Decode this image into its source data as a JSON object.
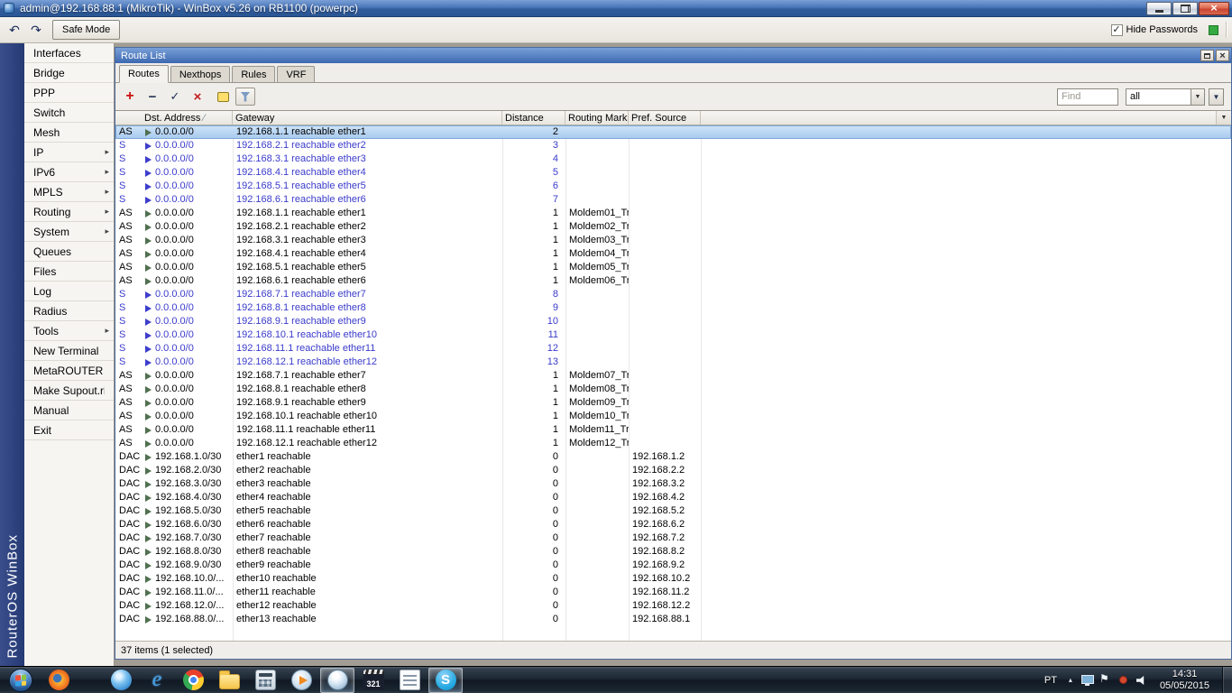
{
  "titlebar": {
    "title": "admin@192.168.88.1 (MikroTik) - WinBox v5.26 on RB1100 (powerpc)"
  },
  "app_toolbar": {
    "icons": [
      "undo-icon",
      "redo-icon"
    ],
    "safe_mode_label": "Safe Mode",
    "hide_passwords_label": "Hide Passwords",
    "hide_passwords_checked": true,
    "status_square_color": "#36a943"
  },
  "sidebar": {
    "brand": "RouterOS WinBox",
    "items": [
      {
        "label": "Interfaces",
        "submenu": false
      },
      {
        "label": "Bridge",
        "submenu": false
      },
      {
        "label": "PPP",
        "submenu": false
      },
      {
        "label": "Switch",
        "submenu": false
      },
      {
        "label": "Mesh",
        "submenu": false
      },
      {
        "label": "IP",
        "submenu": true
      },
      {
        "label": "IPv6",
        "submenu": true
      },
      {
        "label": "MPLS",
        "submenu": true
      },
      {
        "label": "Routing",
        "submenu": true
      },
      {
        "label": "System",
        "submenu": true
      },
      {
        "label": "Queues",
        "submenu": false
      },
      {
        "label": "Files",
        "submenu": false
      },
      {
        "label": "Log",
        "submenu": false
      },
      {
        "label": "Radius",
        "submenu": false
      },
      {
        "label": "Tools",
        "submenu": true
      },
      {
        "label": "New Terminal",
        "submenu": false
      },
      {
        "label": "MetaROUTER",
        "submenu": false
      },
      {
        "label": "Make Supout.rif",
        "submenu": false
      },
      {
        "label": "Manual",
        "submenu": false
      },
      {
        "label": "Exit",
        "submenu": false
      }
    ]
  },
  "route_list": {
    "window_title": "Route List",
    "tabs": [
      "Routes",
      "Nexthops",
      "Rules",
      "VRF"
    ],
    "toolbar_icons": [
      "add-icon",
      "remove-icon",
      "enable-icon",
      "disable-icon",
      "comment-icon",
      "filter-icon"
    ],
    "find_placeholder": "Find",
    "filter_selected": "all",
    "columns": [
      "Dst. Address",
      "Gateway",
      "Distance",
      "Routing Mark",
      "Pref. Source"
    ],
    "sorted_column": "Dst. Address",
    "status_text": "37 items (1 selected)",
    "rows": [
      {
        "flags": "AS",
        "dst": "0.0.0.0/0",
        "gateway": "192.168.1.1 reachable ether1",
        "distance": "2",
        "mark": "",
        "pref": "",
        "selected": true,
        "inactive": false
      },
      {
        "flags": "S",
        "dst": "0.0.0.0/0",
        "gateway": "192.168.2.1 reachable ether2",
        "distance": "3",
        "mark": "",
        "pref": "",
        "inactive": true
      },
      {
        "flags": "S",
        "dst": "0.0.0.0/0",
        "gateway": "192.168.3.1 reachable ether3",
        "distance": "4",
        "mark": "",
        "pref": "",
        "inactive": true
      },
      {
        "flags": "S",
        "dst": "0.0.0.0/0",
        "gateway": "192.168.4.1 reachable ether4",
        "distance": "5",
        "mark": "",
        "pref": "",
        "inactive": true
      },
      {
        "flags": "S",
        "dst": "0.0.0.0/0",
        "gateway": "192.168.5.1 reachable ether5",
        "distance": "6",
        "mark": "",
        "pref": "",
        "inactive": true
      },
      {
        "flags": "S",
        "dst": "0.0.0.0/0",
        "gateway": "192.168.6.1 reachable ether6",
        "distance": "7",
        "mark": "",
        "pref": "",
        "inactive": true
      },
      {
        "flags": "AS",
        "dst": "0.0.0.0/0",
        "gateway": "192.168.1.1 reachable ether1",
        "distance": "1",
        "mark": "Moldem01_Tr...",
        "pref": ""
      },
      {
        "flags": "AS",
        "dst": "0.0.0.0/0",
        "gateway": "192.168.2.1 reachable ether2",
        "distance": "1",
        "mark": "Moldem02_Tr...",
        "pref": ""
      },
      {
        "flags": "AS",
        "dst": "0.0.0.0/0",
        "gateway": "192.168.3.1 reachable ether3",
        "distance": "1",
        "mark": "Moldem03_Tr...",
        "pref": ""
      },
      {
        "flags": "AS",
        "dst": "0.0.0.0/0",
        "gateway": "192.168.4.1 reachable ether4",
        "distance": "1",
        "mark": "Moldem04_Tr...",
        "pref": ""
      },
      {
        "flags": "AS",
        "dst": "0.0.0.0/0",
        "gateway": "192.168.5.1 reachable ether5",
        "distance": "1",
        "mark": "Moldem05_Tr...",
        "pref": ""
      },
      {
        "flags": "AS",
        "dst": "0.0.0.0/0",
        "gateway": "192.168.6.1 reachable ether6",
        "distance": "1",
        "mark": "Moldem06_Tr...",
        "pref": ""
      },
      {
        "flags": "S",
        "dst": "0.0.0.0/0",
        "gateway": "192.168.7.1 reachable ether7",
        "distance": "8",
        "mark": "",
        "pref": "",
        "inactive": true
      },
      {
        "flags": "S",
        "dst": "0.0.0.0/0",
        "gateway": "192.168.8.1 reachable ether8",
        "distance": "9",
        "mark": "",
        "pref": "",
        "inactive": true
      },
      {
        "flags": "S",
        "dst": "0.0.0.0/0",
        "gateway": "192.168.9.1 reachable ether9",
        "distance": "10",
        "mark": "",
        "pref": "",
        "inactive": true
      },
      {
        "flags": "S",
        "dst": "0.0.0.0/0",
        "gateway": "192.168.10.1 reachable ether10",
        "distance": "11",
        "mark": "",
        "pref": "",
        "inactive": true
      },
      {
        "flags": "S",
        "dst": "0.0.0.0/0",
        "gateway": "192.168.11.1 reachable ether11",
        "distance": "12",
        "mark": "",
        "pref": "",
        "inactive": true
      },
      {
        "flags": "S",
        "dst": "0.0.0.0/0",
        "gateway": "192.168.12.1 reachable ether12",
        "distance": "13",
        "mark": "",
        "pref": "",
        "inactive": true
      },
      {
        "flags": "AS",
        "dst": "0.0.0.0/0",
        "gateway": "192.168.7.1 reachable ether7",
        "distance": "1",
        "mark": "Moldem07_Tr...",
        "pref": ""
      },
      {
        "flags": "AS",
        "dst": "0.0.0.0/0",
        "gateway": "192.168.8.1 reachable ether8",
        "distance": "1",
        "mark": "Moldem08_Tr...",
        "pref": ""
      },
      {
        "flags": "AS",
        "dst": "0.0.0.0/0",
        "gateway": "192.168.9.1 reachable ether9",
        "distance": "1",
        "mark": "Moldem09_Tr...",
        "pref": ""
      },
      {
        "flags": "AS",
        "dst": "0.0.0.0/0",
        "gateway": "192.168.10.1 reachable ether10",
        "distance": "1",
        "mark": "Moldem10_Tr...",
        "pref": ""
      },
      {
        "flags": "AS",
        "dst": "0.0.0.0/0",
        "gateway": "192.168.11.1 reachable ether11",
        "distance": "1",
        "mark": "Moldem11_Tr...",
        "pref": ""
      },
      {
        "flags": "AS",
        "dst": "0.0.0.0/0",
        "gateway": "192.168.12.1 reachable ether12",
        "distance": "1",
        "mark": "Moldem12_Tr...",
        "pref": ""
      },
      {
        "flags": "DAC",
        "dst": "192.168.1.0/30",
        "gateway": "ether1 reachable",
        "distance": "0",
        "mark": "",
        "pref": "192.168.1.2"
      },
      {
        "flags": "DAC",
        "dst": "192.168.2.0/30",
        "gateway": "ether2 reachable",
        "distance": "0",
        "mark": "",
        "pref": "192.168.2.2"
      },
      {
        "flags": "DAC",
        "dst": "192.168.3.0/30",
        "gateway": "ether3 reachable",
        "distance": "0",
        "mark": "",
        "pref": "192.168.3.2"
      },
      {
        "flags": "DAC",
        "dst": "192.168.4.0/30",
        "gateway": "ether4 reachable",
        "distance": "0",
        "mark": "",
        "pref": "192.168.4.2"
      },
      {
        "flags": "DAC",
        "dst": "192.168.5.0/30",
        "gateway": "ether5 reachable",
        "distance": "0",
        "mark": "",
        "pref": "192.168.5.2"
      },
      {
        "flags": "DAC",
        "dst": "192.168.6.0/30",
        "gateway": "ether6 reachable",
        "distance": "0",
        "mark": "",
        "pref": "192.168.6.2"
      },
      {
        "flags": "DAC",
        "dst": "192.168.7.0/30",
        "gateway": "ether7 reachable",
        "distance": "0",
        "mark": "",
        "pref": "192.168.7.2"
      },
      {
        "flags": "DAC",
        "dst": "192.168.8.0/30",
        "gateway": "ether8 reachable",
        "distance": "0",
        "mark": "",
        "pref": "192.168.8.2"
      },
      {
        "flags": "DAC",
        "dst": "192.168.9.0/30",
        "gateway": "ether9 reachable",
        "distance": "0",
        "mark": "",
        "pref": "192.168.9.2"
      },
      {
        "flags": "DAC",
        "dst": "192.168.10.0/...",
        "gateway": "ether10 reachable",
        "distance": "0",
        "mark": "",
        "pref": "192.168.10.2"
      },
      {
        "flags": "DAC",
        "dst": "192.168.11.0/...",
        "gateway": "ether11 reachable",
        "distance": "0",
        "mark": "",
        "pref": "192.168.11.2"
      },
      {
        "flags": "DAC",
        "dst": "192.168.12.0/...",
        "gateway": "ether12 reachable",
        "distance": "0",
        "mark": "",
        "pref": "192.168.12.2"
      },
      {
        "flags": "DAC",
        "dst": "192.168.88.0/...",
        "gateway": "ether13 reachable",
        "distance": "0",
        "mark": "",
        "pref": "192.168.88.1"
      }
    ]
  },
  "taskbar": {
    "apps": [
      {
        "id": "firefox",
        "open": false
      },
      {
        "id": "blue-browser",
        "open": false
      },
      {
        "id": "internet-explorer",
        "open": false
      },
      {
        "id": "chrome",
        "open": false
      },
      {
        "id": "file-explorer",
        "open": false
      },
      {
        "id": "calculator",
        "open": false
      },
      {
        "id": "media-player",
        "open": false
      },
      {
        "id": "winbox",
        "open": true
      },
      {
        "id": "mpc",
        "label": "321",
        "open": false
      },
      {
        "id": "whiteboard",
        "open": false
      },
      {
        "id": "skype",
        "open": true
      }
    ],
    "tray": {
      "language": "PT",
      "icons": [
        "display",
        "flag",
        "notification",
        "volume"
      ],
      "time": "14:31",
      "date": "05/05/2015"
    }
  }
}
